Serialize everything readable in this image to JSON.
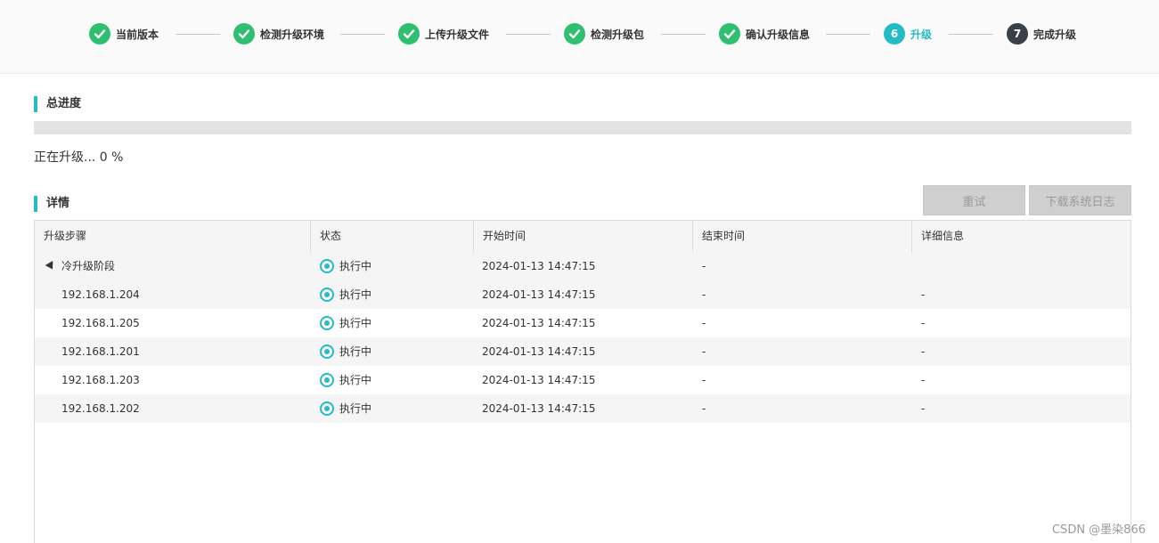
{
  "stepper": {
    "steps": [
      {
        "label": "当前版本",
        "state": "done",
        "number": ""
      },
      {
        "label": "检测升级环境",
        "state": "done",
        "number": ""
      },
      {
        "label": "上传升级文件",
        "state": "done",
        "number": ""
      },
      {
        "label": "检测升级包",
        "state": "done",
        "number": ""
      },
      {
        "label": "确认升级信息",
        "state": "done",
        "number": ""
      },
      {
        "label": "升级",
        "state": "active",
        "number": "6"
      },
      {
        "label": "完成升级",
        "state": "pending",
        "number": "7"
      }
    ]
  },
  "overall": {
    "title": "总进度",
    "progress_text": "正在升级... 0 %",
    "progress_fraction": 0
  },
  "details": {
    "title": "详情",
    "retry_label": "重试",
    "download_log_label": "下载系统日志"
  },
  "table": {
    "headers": [
      "升级步骤",
      "状态",
      "开始时间",
      "结束时间",
      "详细信息"
    ],
    "rows": [
      {
        "step": "冷升级阶段",
        "status": "执行中",
        "start": "2024-01-13 14:47:15",
        "end": "-",
        "detail": ""
      },
      {
        "step": "192.168.1.204",
        "status": "执行中",
        "start": "2024-01-13 14:47:15",
        "end": "-",
        "detail": "-"
      },
      {
        "step": "192.168.1.205",
        "status": "执行中",
        "start": "2024-01-13 14:47:15",
        "end": "-",
        "detail": "-"
      },
      {
        "step": "192.168.1.201",
        "status": "执行中",
        "start": "2024-01-13 14:47:15",
        "end": "-",
        "detail": "-"
      },
      {
        "step": "192.168.1.203",
        "status": "执行中",
        "start": "2024-01-13 14:47:15",
        "end": "-",
        "detail": "-"
      },
      {
        "step": "192.168.1.202",
        "status": "执行中",
        "start": "2024-01-13 14:47:15",
        "end": "-",
        "detail": "-"
      }
    ]
  },
  "watermark": "CSDN @墨染866",
  "colors": {
    "accent": "#23bcc4",
    "done": "#2fbf71",
    "pending": "#3a3f48"
  }
}
